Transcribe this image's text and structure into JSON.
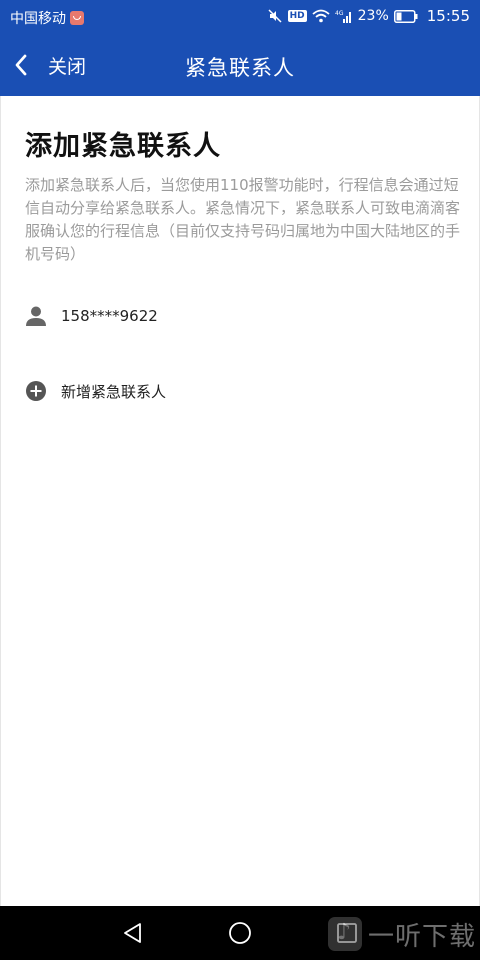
{
  "status_bar": {
    "carrier": "中国移动",
    "hd_badge": "HD",
    "battery": "23%",
    "time": "15:55",
    "icons": [
      "carrier-badge-icon",
      "mute-icon",
      "wifi-icon",
      "signal-icon",
      "battery-icon"
    ]
  },
  "app_bar": {
    "back_label": "关闭",
    "title": "紧急联系人",
    "color": "#1a4fb4"
  },
  "page": {
    "title": "添加紧急联系人",
    "description": "添加紧急联系人后，当您使用110报警功能时，行程信息会通过短信自动分享给紧急联系人。紧急情况下，紧急联系人可致电滴滴客服确认您的行程信息（目前仅支持号码归属地为中国大陆地区的手机号码）"
  },
  "contacts": [
    {
      "phone": "158****9622",
      "icon": "person-icon"
    }
  ],
  "add_contact": {
    "label": "新增紧急联系人",
    "icon": "add-circle-icon"
  },
  "nav_bar": {
    "icons": [
      "nav-back-icon",
      "nav-home-icon",
      "nav-recent-icon"
    ]
  },
  "watermark": {
    "text": "一听下载"
  }
}
